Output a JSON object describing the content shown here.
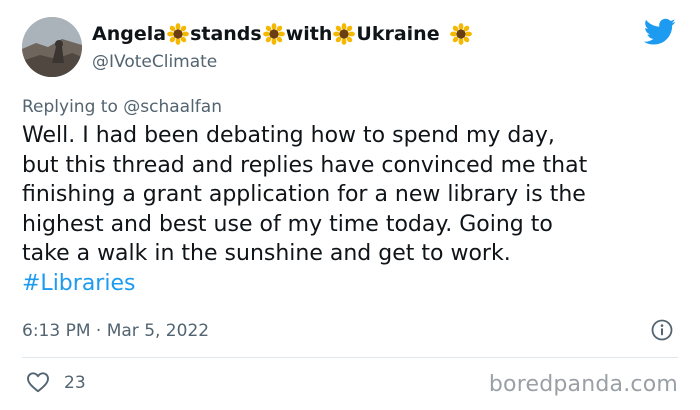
{
  "tweet": {
    "display_name_parts": [
      "Angela",
      "stands",
      "with",
      "Ukraine"
    ],
    "name_emoji": "sunflower-icon",
    "handle": "@IVoteClimate",
    "replying_prefix": "Replying to",
    "replying_to": "@schaalfan",
    "body_lines": [
      "Well. I had been debating how to spend my day,",
      "but this thread and replies have convinced me that",
      "finishing a grant application for a new library is the",
      "highest and best use of my time today. Going to",
      "take a walk in the sunshine and get to work."
    ],
    "hashtag": "#Libraries",
    "timestamp": "6:13 PM · Mar 5, 2022",
    "like_count": "23"
  },
  "watermark": "boredpanda.com",
  "colors": {
    "twitter_blue": "#1d9bf0",
    "secondary_text": "#536471",
    "primary_text": "#0f1419"
  },
  "icons": {
    "brand": "twitter-bird-icon",
    "info": "info-icon",
    "like": "heart-icon"
  }
}
